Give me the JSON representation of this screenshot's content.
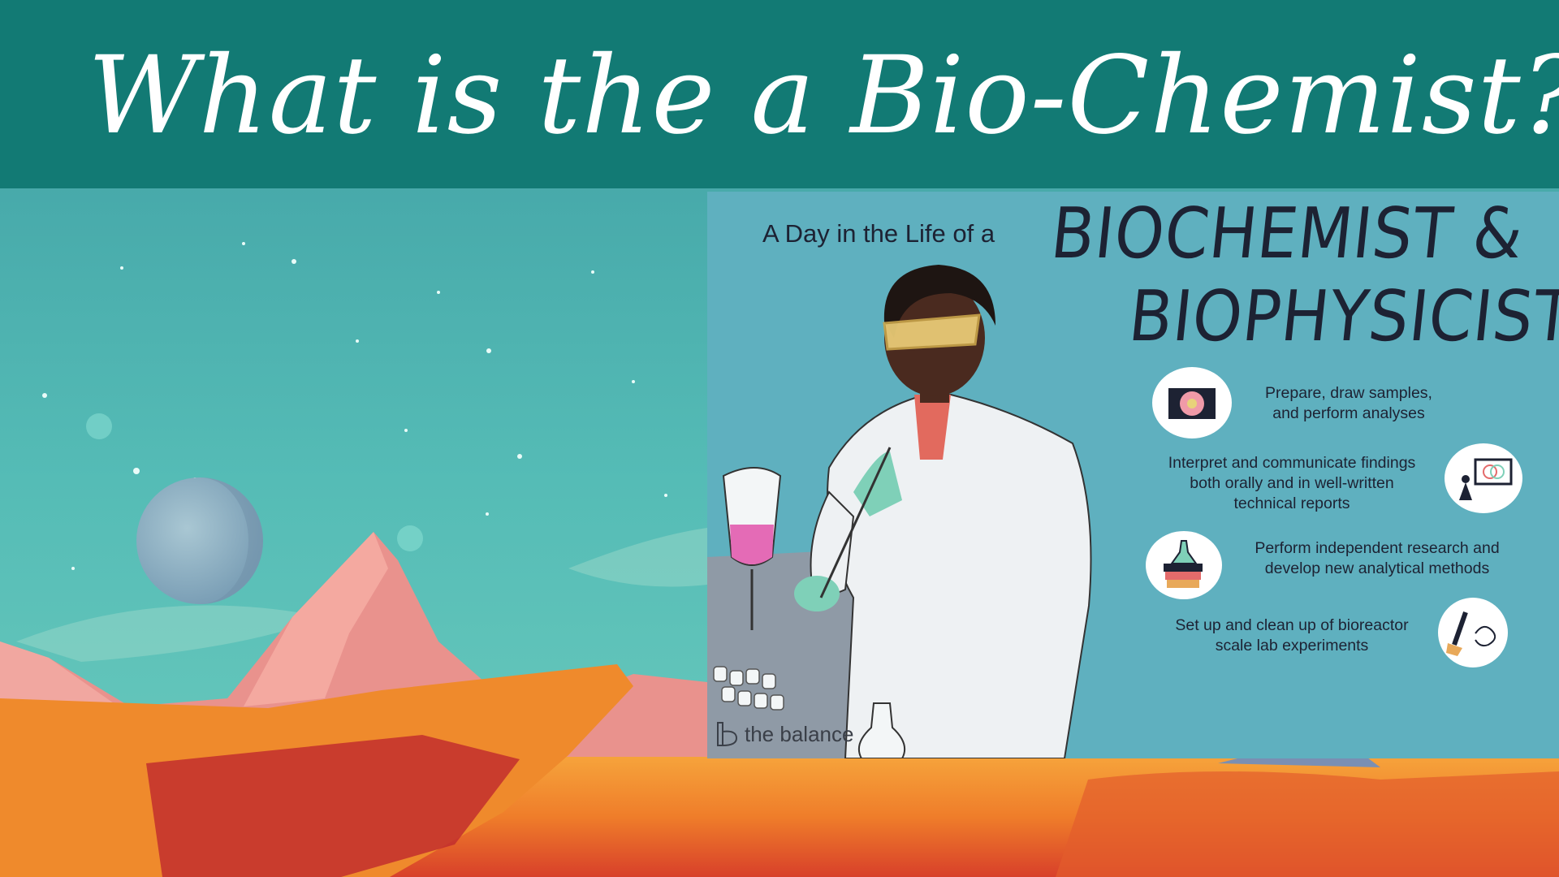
{
  "title": "What is the a Bio-Chemist?",
  "infographic": {
    "heading_small": "A Day in the Life of a",
    "heading_line1": "BIOCHEMIST &",
    "heading_line2": "BIOPHYSICIST",
    "duties": [
      {
        "line1": "Prepare, draw samples,",
        "line2": "and perform analyses",
        "line3": "",
        "icon": "petri-dish-icon"
      },
      {
        "line1": "Interpret and communicate findings",
        "line2": "both orally and in well-written",
        "line3": "technical reports",
        "icon": "presentation-icon"
      },
      {
        "line1": "Perform independent research and",
        "line2": "develop new analytical methods",
        "line3": "",
        "icon": "books-flask-icon"
      },
      {
        "line1": "Set up and clean up of bioreactor",
        "line2": "scale lab experiments",
        "line3": "",
        "icon": "brush-icon"
      }
    ],
    "brand": "the balance"
  },
  "colors": {
    "title_band": "#127a74",
    "sky": "#4fb3b3",
    "infographic_bg": "#5fb0bf",
    "ground": "#f08a2e"
  }
}
